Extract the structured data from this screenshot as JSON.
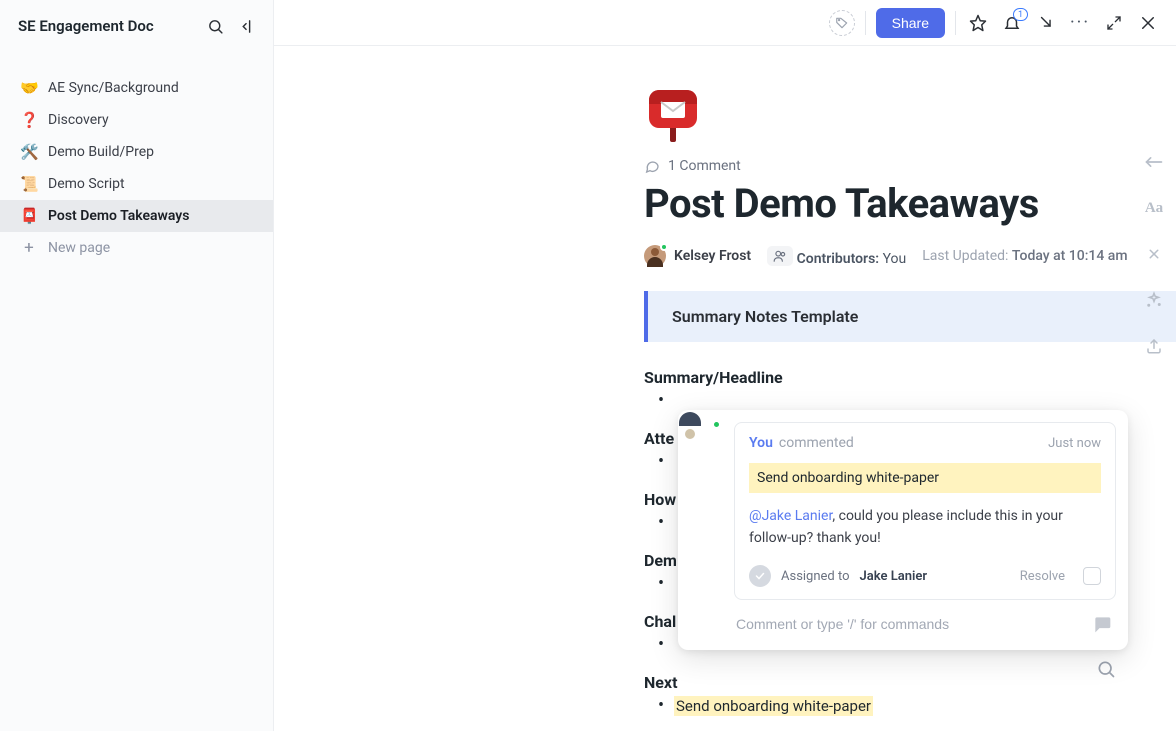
{
  "sidebar": {
    "title": "SE Engagement Doc",
    "items": [
      {
        "emoji": "🤝",
        "label": "AE Sync/Background"
      },
      {
        "emoji": "❓",
        "label": "Discovery"
      },
      {
        "emoji": "🛠️",
        "label": "Demo Build/Prep"
      },
      {
        "emoji": "📜",
        "label": "Demo Script"
      },
      {
        "emoji": "📮",
        "label": "Post Demo Takeaways"
      }
    ],
    "new_page_label": "New page"
  },
  "topbar": {
    "share_label": "Share",
    "notification_count": "1"
  },
  "doc": {
    "comment_count_label": "1 Comment",
    "title": "Post Demo Takeaways",
    "owner_name": "Kelsey Frost",
    "contributors_label": "Contributors:",
    "contributors_value": "You",
    "updated_label": "Last Updated:",
    "updated_value": "Today at 10:14 am",
    "template_callout": "Summary Notes Template",
    "sections": [
      {
        "heading": "Summary/Headline",
        "items": [
          ""
        ]
      },
      {
        "heading": "Atte",
        "items": [
          ""
        ]
      },
      {
        "heading": "How",
        "items": [
          ""
        ]
      },
      {
        "heading": "Dem",
        "items": [
          ""
        ]
      },
      {
        "heading": "Chal",
        "items": [
          ""
        ]
      },
      {
        "heading": "Next",
        "items": [
          "Send onboarding white-paper"
        ]
      }
    ]
  },
  "comment_popover": {
    "author_you": "You",
    "action_text": "commented",
    "timestamp": "Just now",
    "quoted_text": "Send onboarding white-paper",
    "mention_name": "@Jake Lanier",
    "body_text": ", could you please include this in your follow-up? thank you!",
    "assigned_label": "Assigned to",
    "assignee_name": "Jake Lanier",
    "resolve_label": "Resolve",
    "reply_placeholder": "Comment or type '/' for commands"
  }
}
